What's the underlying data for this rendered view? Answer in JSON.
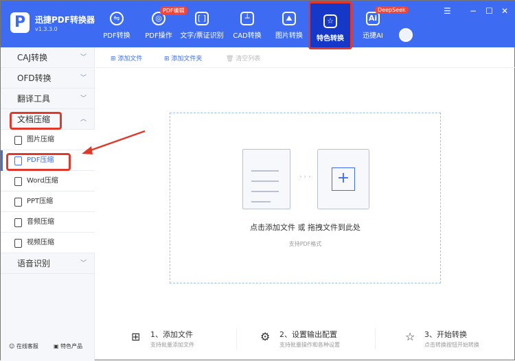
{
  "app": {
    "name": "迅捷PDF转换器",
    "version": "v1.3.3.0",
    "logo_letter": "P"
  },
  "nav": [
    {
      "label": "PDF转换",
      "icon": "convert-circle-icon"
    },
    {
      "label": "PDF操作",
      "icon": "pdf-operate-icon",
      "badge": "PDF编辑"
    },
    {
      "label": "文字/票证识别",
      "icon": "ocr-icon"
    },
    {
      "label": "CAD转换",
      "icon": "cad-icon"
    },
    {
      "label": "图片转换",
      "icon": "image-icon"
    },
    {
      "label": "特色转换",
      "icon": "star-convert-icon",
      "active": true
    },
    {
      "label": "迅捷AI",
      "icon": "ai-icon",
      "badge": "DeepSeek"
    }
  ],
  "window": {
    "menu": "☰",
    "minimize": "−",
    "maximize": "☐",
    "close": "✕"
  },
  "sidebar": {
    "groups": [
      "CAJ转换",
      "OFD转换",
      "翻译工具",
      "文档压缩",
      "语音识别"
    ],
    "sub": [
      "图片压缩",
      "PDF压缩",
      "Word压缩",
      "PPT压缩",
      "音频压缩",
      "视频压缩"
    ],
    "selected": "PDF压缩",
    "footer": {
      "service": "在线客服",
      "products": "特色产品"
    }
  },
  "toolbar": {
    "add_file": "添加文件",
    "add_folder": "添加文件夹",
    "clear": "清空列表"
  },
  "drop": {
    "title": "点击添加文件 或 拖拽文件到此处",
    "subtitle": "支持PDF格式",
    "arrows": "› › ›",
    "plus": "+"
  },
  "steps": [
    {
      "title": "1、添加文件",
      "sub": "支持批量添加文件"
    },
    {
      "title": "2、设置输出配置",
      "sub": "支持批量操作和各种设置"
    },
    {
      "title": "3、开始转换",
      "sub": "点击转换按钮开始转换"
    }
  ],
  "colors": {
    "brand": "#3d6cf3",
    "highlight": "#e0392b"
  }
}
